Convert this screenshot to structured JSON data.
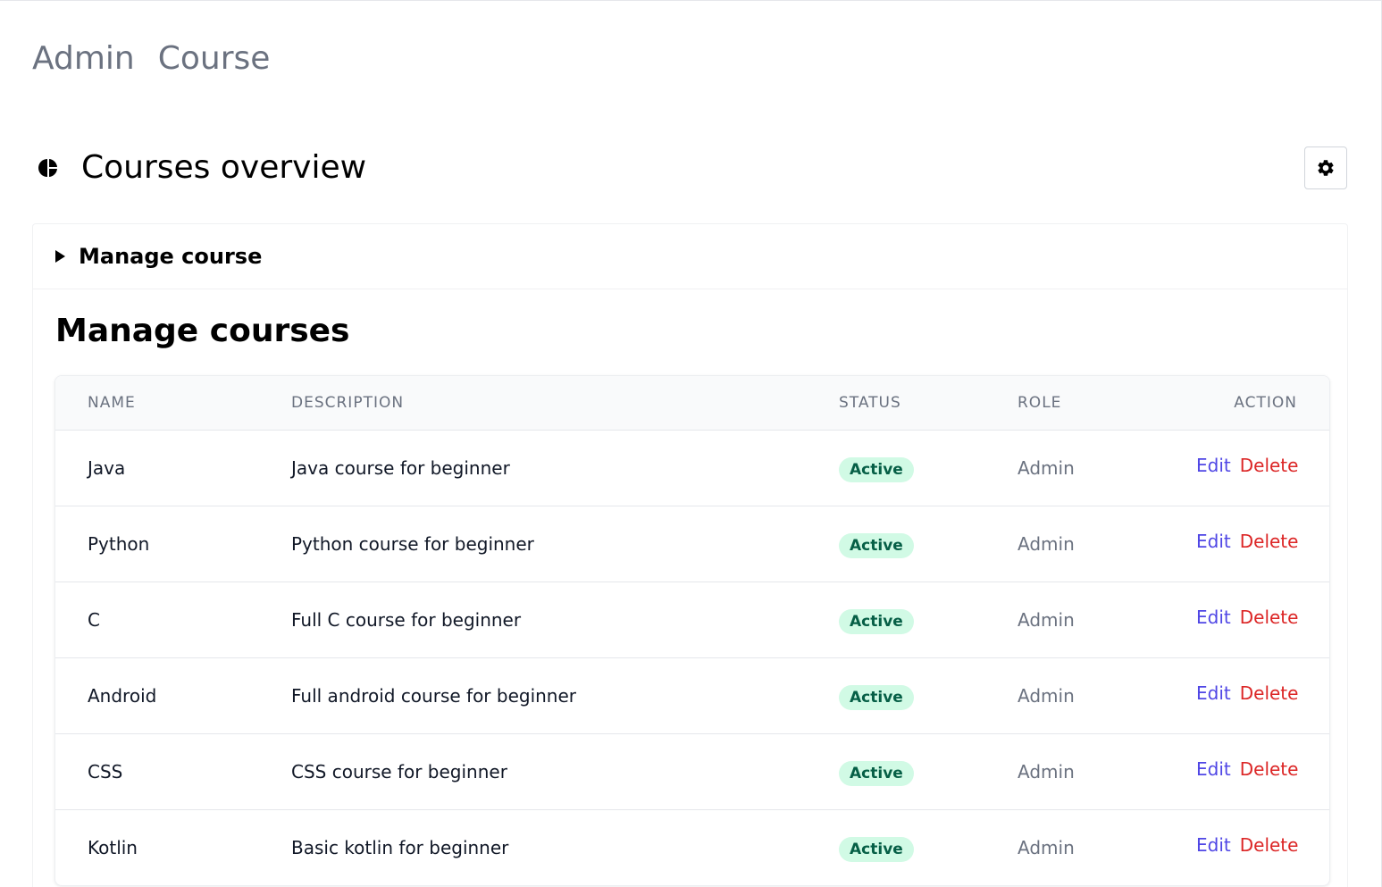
{
  "breadcrumb": {
    "items": [
      "Admin",
      "Course"
    ]
  },
  "header": {
    "title": "Courses overview",
    "icon": "pie-chart-icon",
    "settings_icon": "gear-icon"
  },
  "manage_toggle": {
    "label": "Manage course"
  },
  "section": {
    "title": "Manage courses"
  },
  "table": {
    "columns": [
      "NAME",
      "DESCRIPTION",
      "STATUS",
      "ROLE",
      "ACTION"
    ],
    "rows": [
      {
        "name": "Java",
        "description": "Java course for beginner",
        "status": "Active",
        "role": "Admin",
        "edit": "Edit",
        "delete": "Delete"
      },
      {
        "name": "Python",
        "description": "Python course for beginner",
        "status": "Active",
        "role": "Admin",
        "edit": "Edit",
        "delete": "Delete"
      },
      {
        "name": "C",
        "description": "Full C course for beginner",
        "status": "Active",
        "role": "Admin",
        "edit": "Edit",
        "delete": "Delete"
      },
      {
        "name": "Android",
        "description": "Full android course for beginner",
        "status": "Active",
        "role": "Admin",
        "edit": "Edit",
        "delete": "Delete"
      },
      {
        "name": "CSS",
        "description": "CSS course for beginner",
        "status": "Active",
        "role": "Admin",
        "edit": "Edit",
        "delete": "Delete"
      },
      {
        "name": "Kotlin",
        "description": "Basic kotlin for beginner",
        "status": "Active",
        "role": "Admin",
        "edit": "Edit",
        "delete": "Delete"
      }
    ]
  },
  "colors": {
    "badge_bg": "#d1fae5",
    "badge_text": "#065f46",
    "edit": "#4f46e5",
    "delete": "#dc2626",
    "muted": "#6b7280"
  }
}
